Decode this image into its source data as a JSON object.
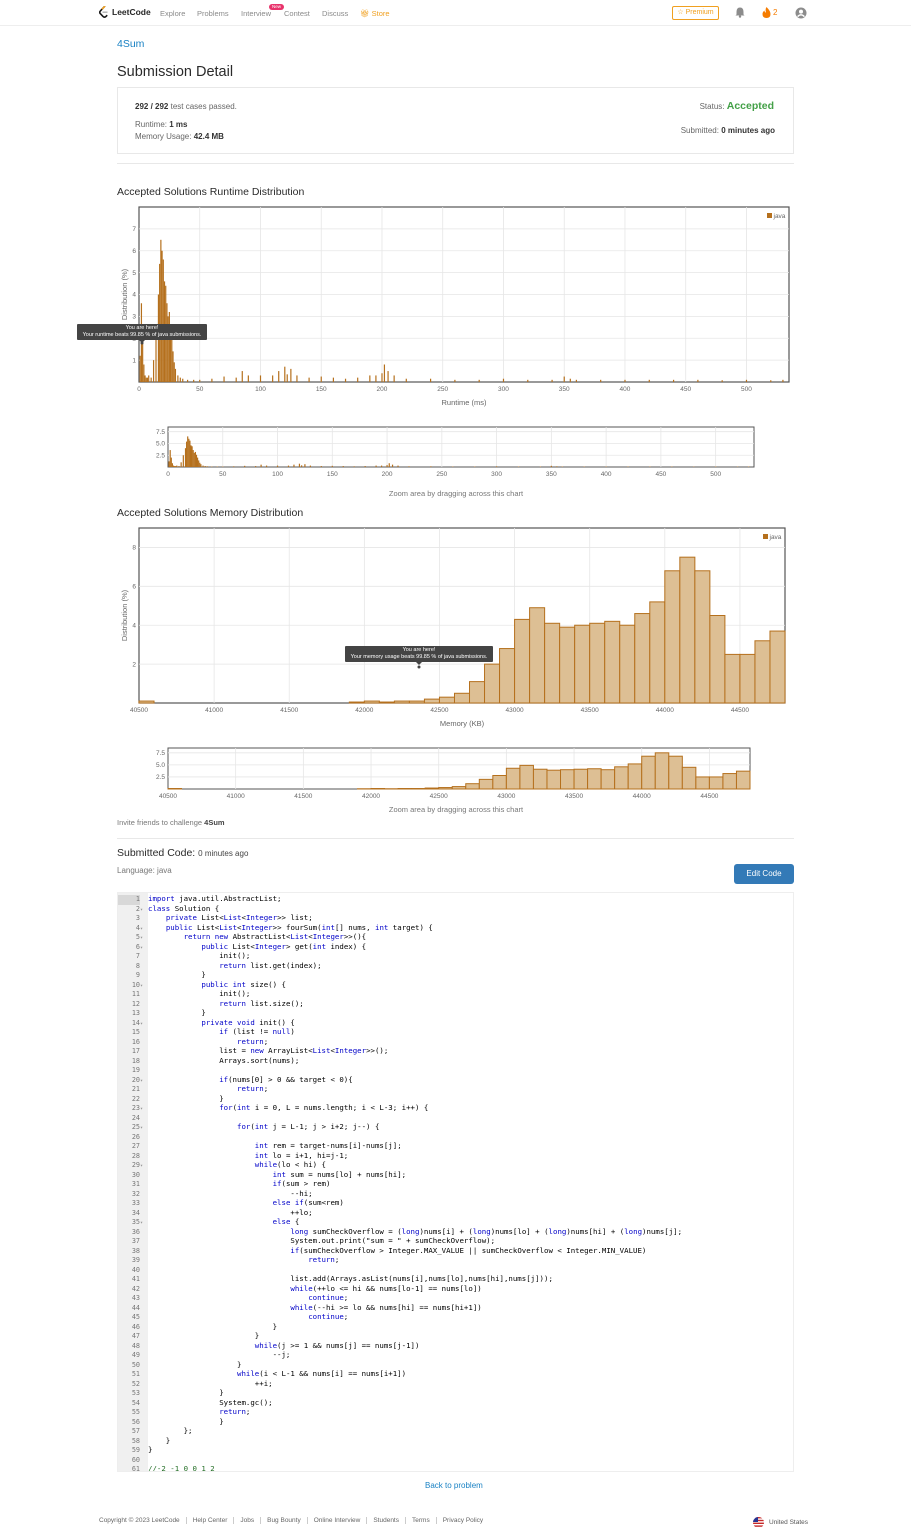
{
  "nav": {
    "logo": "LeetCode",
    "items": [
      "Explore",
      "Problems",
      "Interview",
      "Contest",
      "Discuss",
      "Store"
    ],
    "new_badge": "New",
    "premium": "Premium",
    "streak": "2"
  },
  "problem": {
    "name": "4Sum"
  },
  "page_title": "Submission Detail",
  "summary": {
    "tests_passed": "292 / 292",
    "tests_suffix": "test cases passed.",
    "runtime_label": "Runtime:",
    "runtime_value": "1 ms",
    "memory_label": "Memory Usage:",
    "memory_value": "42.4 MB",
    "status_label": "Status:",
    "status_value": "Accepted",
    "submitted_label": "Submitted:",
    "submitted_value": "0 minutes ago"
  },
  "runtime_section": {
    "title": "Accepted Solutions Runtime Distribution",
    "tooltip_line1": "You are here!",
    "tooltip_line2": "Your runtime beats 99.85 % of java submissions.",
    "zoom_caption": "Zoom area by dragging across this chart"
  },
  "memory_section": {
    "title": "Accepted Solutions Memory Distribution",
    "tooltip_line1": "You are here!",
    "tooltip_line2": "Your memory usage beats 99.85 % of java submissions.",
    "zoom_caption": "Zoom area by dragging across this chart"
  },
  "chart_data": [
    {
      "type": "bar",
      "name": "runtime-distribution",
      "xlabel": "Runtime (ms)",
      "ylabel": "Distribution (%)",
      "legend": [
        "java"
      ],
      "legend_position": "top-right",
      "xlim": [
        0,
        535
      ],
      "ylim": [
        0,
        8
      ],
      "xticks": [
        0,
        50,
        100,
        150,
        200,
        250,
        300,
        350,
        400,
        450,
        500
      ],
      "yticks": [
        1,
        2,
        3,
        4,
        5,
        6,
        7
      ],
      "zoom_yticks": [
        "2.5",
        "5.0",
        "7.5"
      ],
      "grid": true,
      "color": "#b5701d",
      "x": [
        1,
        2,
        3,
        4,
        5,
        6,
        7,
        8,
        10,
        12,
        14,
        16,
        17,
        18,
        19,
        20,
        21,
        22,
        23,
        24,
        25,
        26,
        27,
        28,
        29,
        30,
        32,
        34,
        36,
        40,
        45,
        50,
        60,
        70,
        80,
        85,
        90,
        100,
        110,
        115,
        120,
        122,
        125,
        130,
        140,
        150,
        160,
        170,
        180,
        190,
        195,
        200,
        202,
        205,
        210,
        220,
        240,
        260,
        280,
        300,
        320,
        340,
        350,
        355,
        360,
        380,
        400,
        420,
        440,
        460,
        480,
        500,
        520,
        530
      ],
      "values": [
        1.2,
        3.6,
        2.0,
        0.8,
        0.3,
        0.2,
        0.2,
        0.3,
        0.2,
        1.0,
        2.5,
        4.0,
        5.4,
        6.5,
        6.0,
        5.6,
        4.6,
        4.4,
        3.6,
        3.0,
        3.2,
        2.6,
        2.0,
        1.4,
        0.9,
        0.6,
        0.3,
        0.2,
        0.15,
        0.1,
        0.1,
        0.1,
        0.15,
        0.25,
        0.2,
        0.5,
        0.3,
        0.3,
        0.3,
        0.5,
        0.7,
        0.35,
        0.6,
        0.3,
        0.2,
        0.25,
        0.2,
        0.15,
        0.2,
        0.3,
        0.3,
        0.4,
        0.8,
        0.5,
        0.3,
        0.15,
        0.15,
        0.1,
        0.1,
        0.15,
        0.1,
        0.1,
        0.25,
        0.15,
        0.1,
        0.1,
        0.1,
        0.1,
        0.1,
        0.1,
        0.08,
        0.1,
        0.08,
        0.1
      ]
    },
    {
      "type": "bar",
      "name": "memory-distribution",
      "xlabel": "Memory (KB)",
      "ylabel": "Distribution (%)",
      "legend": [
        "java"
      ],
      "legend_position": "top-right",
      "xlim": [
        40500,
        44800
      ],
      "ylim": [
        0,
        9
      ],
      "xticks": [
        40500,
        41000,
        41500,
        42000,
        42500,
        43000,
        43500,
        44000,
        44500
      ],
      "yticks": [
        2,
        4,
        6,
        8
      ],
      "zoom_yticks": [
        "2.5",
        "5.0",
        "7.5"
      ],
      "grid": true,
      "color": "#ddbf94",
      "bin_width": 100,
      "x": [
        40500,
        41900,
        42000,
        42100,
        42200,
        42300,
        42400,
        42500,
        42600,
        42700,
        42800,
        42900,
        43000,
        43100,
        43200,
        43300,
        43400,
        43500,
        43600,
        43700,
        43800,
        43900,
        44000,
        44100,
        44200,
        44300,
        44400,
        44500,
        44600,
        44700
      ],
      "values": [
        0.1,
        0.05,
        0.1,
        0.05,
        0.1,
        0.1,
        0.2,
        0.3,
        0.5,
        1.1,
        2.0,
        2.8,
        4.3,
        4.9,
        4.1,
        3.9,
        4.0,
        4.1,
        4.2,
        4.0,
        4.6,
        5.2,
        6.8,
        7.5,
        6.8,
        4.5,
        2.5,
        2.5,
        3.2,
        3.7
      ]
    }
  ],
  "invite": {
    "text": "Invite friends to challenge",
    "problem": "4Sum"
  },
  "code_section": {
    "title": "Submitted Code:",
    "time": "0 minutes ago",
    "language": "Language: java",
    "edit_button": "Edit Code"
  },
  "code_lines": [
    "import java.util.AbstractList;",
    "class Solution {",
    "    private List<List<Integer>> list;",
    "    public List<List<Integer>> fourSum(int[] nums, int target) {",
    "        return new AbstractList<List<Integer>>(){",
    "            public List<Integer> get(int index) {",
    "                init();",
    "                return list.get(index);",
    "            }",
    "            public int size() {",
    "                init();",
    "                return list.size();",
    "            }",
    "            private void init() {",
    "                if (list != null)",
    "                    return;",
    "                list = new ArrayList<List<Integer>>();",
    "                Arrays.sort(nums);",
    "",
    "                if(nums[0] > 0 && target < 0){",
    "                    return;",
    "                }",
    "                for(int i = 0, L = nums.length; i < L-3; i++) {",
    "",
    "                    for(int j = L-1; j > i+2; j--) {",
    "",
    "                        int rem = target-nums[i]-nums[j];",
    "                        int lo = i+1, hi=j-1;",
    "                        while(lo < hi) {",
    "                            int sum = nums[lo] + nums[hi];",
    "                            if(sum > rem)",
    "                                --hi;",
    "                            else if(sum<rem)",
    "                                ++lo;",
    "                            else {",
    "                                long sumCheckOverflow = (long)nums[i] + (long)nums[lo] + (long)nums[hi] + (long)nums[j];",
    "                                System.out.print(\"sum = \" + sumCheckOverflow);",
    "                                if(sumCheckOverflow > Integer.MAX_VALUE || sumCheckOverflow < Integer.MIN_VALUE)",
    "                                    return;",
    "",
    "                                list.add(Arrays.asList(nums[i],nums[lo],nums[hi],nums[j]));",
    "                                while(++lo <= hi && nums[lo-1] == nums[lo])",
    "                                    continue;",
    "                                while(--hi >= lo && nums[hi] == nums[hi+1])",
    "                                    continue;",
    "                            }",
    "                        }",
    "                        while(j >= 1 && nums[j] == nums[j-1])",
    "                            --j;",
    "                    }",
    "                    while(i < L-1 && nums[i] == nums[i+1])",
    "                        ++i;",
    "                }",
    "                System.gc();",
    "                return;",
    "                }",
    "        };",
    "    }",
    "}",
    "",
    "//-2 -1 0 0 1 2"
  ],
  "fold_lines": [
    2,
    4,
    5,
    6,
    10,
    14,
    20,
    23,
    25,
    29,
    35
  ],
  "back_link": "Back to problem",
  "footer": {
    "links": [
      "Copyright © 2023 LeetCode",
      "Help Center",
      "Jobs",
      "Bug Bounty",
      "Online Interview",
      "Students",
      "Terms",
      "Privacy Policy"
    ],
    "country": "United States"
  }
}
